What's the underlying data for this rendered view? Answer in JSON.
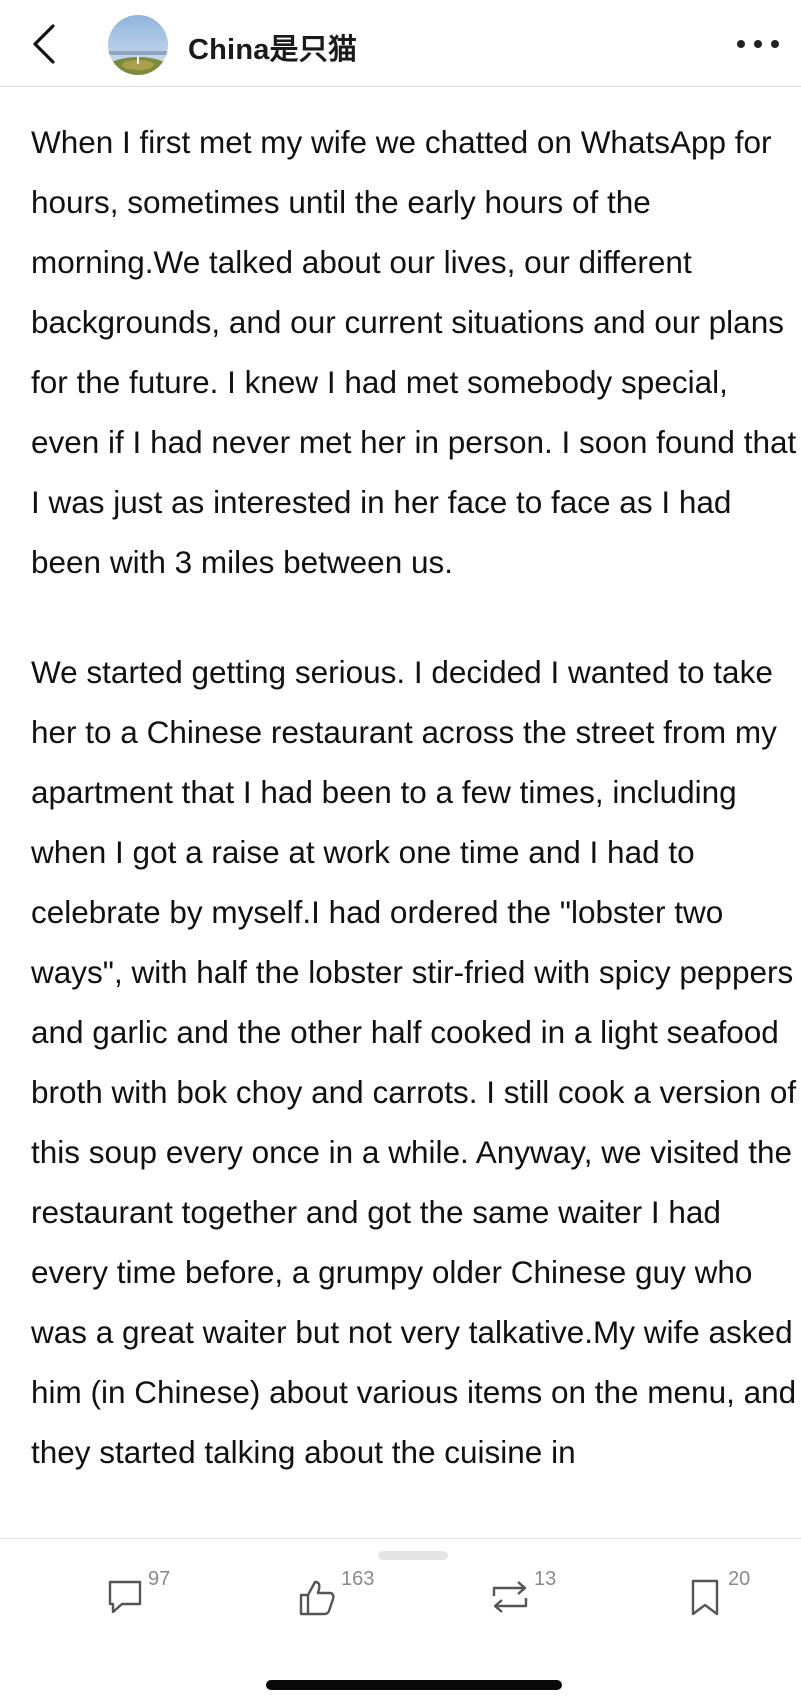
{
  "header": {
    "author_name": "China是只猫",
    "back_icon": "chevron-left-icon",
    "more_icon": "more-horizontal-icon"
  },
  "article": {
    "paragraphs": [
      "When I first met my wife we chatted on WhatsApp for hours, sometimes until the early hours of the morning.We talked about our lives, our different backgrounds, and our current situations and our plans for the future. I knew I had met somebody special, even if I had never met her in person. I soon found that I was just as interested in her face to face as I had been with 3 miles between us.",
      "We started getting serious. I decided I wanted to take her to a Chinese restaurant across the street from my apartment that I had been to a few times, including when I got a raise at work one time and I had to celebrate by myself.I had ordered the \"lobster two ways\", with half the lobster stir-fried with spicy peppers and garlic and the other half cooked in a light seafood broth with bok choy and carrots. I still cook a version of this soup every once in a while. Anyway, we visited the restaurant together and got the same waiter I had every time before, a grumpy older Chinese guy who was a great waiter but not very talkative.My wife asked him (in Chinese) about various items on the menu, and they started talking about the cuisine in"
    ]
  },
  "actions": {
    "comments": {
      "icon": "comment-icon",
      "count": "97"
    },
    "likes": {
      "icon": "thumbs-up-icon",
      "count": "163"
    },
    "reposts": {
      "icon": "repost-icon",
      "count": "13"
    },
    "bookmarks": {
      "icon": "bookmark-icon",
      "count": "20"
    }
  },
  "colors": {
    "text": "#111111",
    "icon": "#555555",
    "count": "#8a8a8a",
    "divider": "#d9d9d9"
  }
}
